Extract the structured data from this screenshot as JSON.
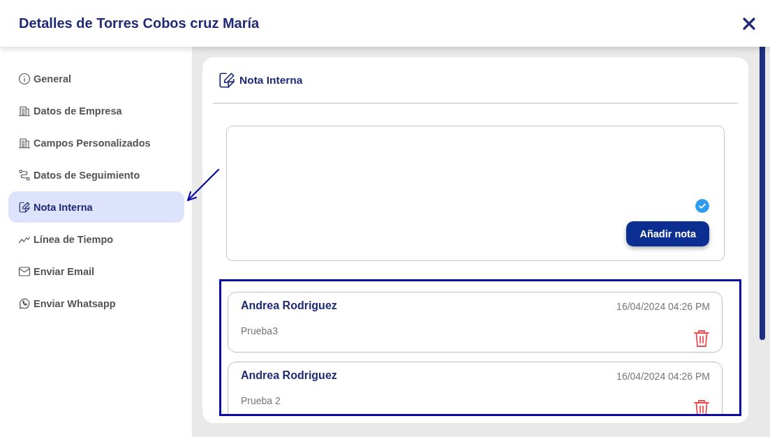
{
  "window": {
    "title": "Detalles de Torres Cobos cruz María"
  },
  "sidebar": {
    "items": [
      {
        "label": "General",
        "kind": "info",
        "selected": false
      },
      {
        "label": "Datos de Empresa",
        "kind": "building",
        "selected": false
      },
      {
        "label": "Campos Personalizados",
        "kind": "building",
        "selected": false
      },
      {
        "label": "Datos de Seguimiento",
        "kind": "route",
        "selected": false
      },
      {
        "label": "Nota Interna",
        "kind": "edit",
        "selected": true
      },
      {
        "label": "Línea de Tiempo",
        "kind": "trend",
        "selected": false
      },
      {
        "label": "Enviar Email",
        "kind": "mail",
        "selected": false
      },
      {
        "label": "Enviar Whatsapp",
        "kind": "whatsapp",
        "selected": false
      }
    ]
  },
  "panel": {
    "title": "Nota Interna",
    "add_button": "Añadir nota",
    "notes": [
      {
        "author": "Andrea Rodriguez",
        "date": "16/04/2024 04:26 PM",
        "text": "Prueba3"
      },
      {
        "author": "Andrea Rodriguez",
        "date": "16/04/2024 04:26 PM",
        "text": "Prueba 2"
      }
    ]
  }
}
